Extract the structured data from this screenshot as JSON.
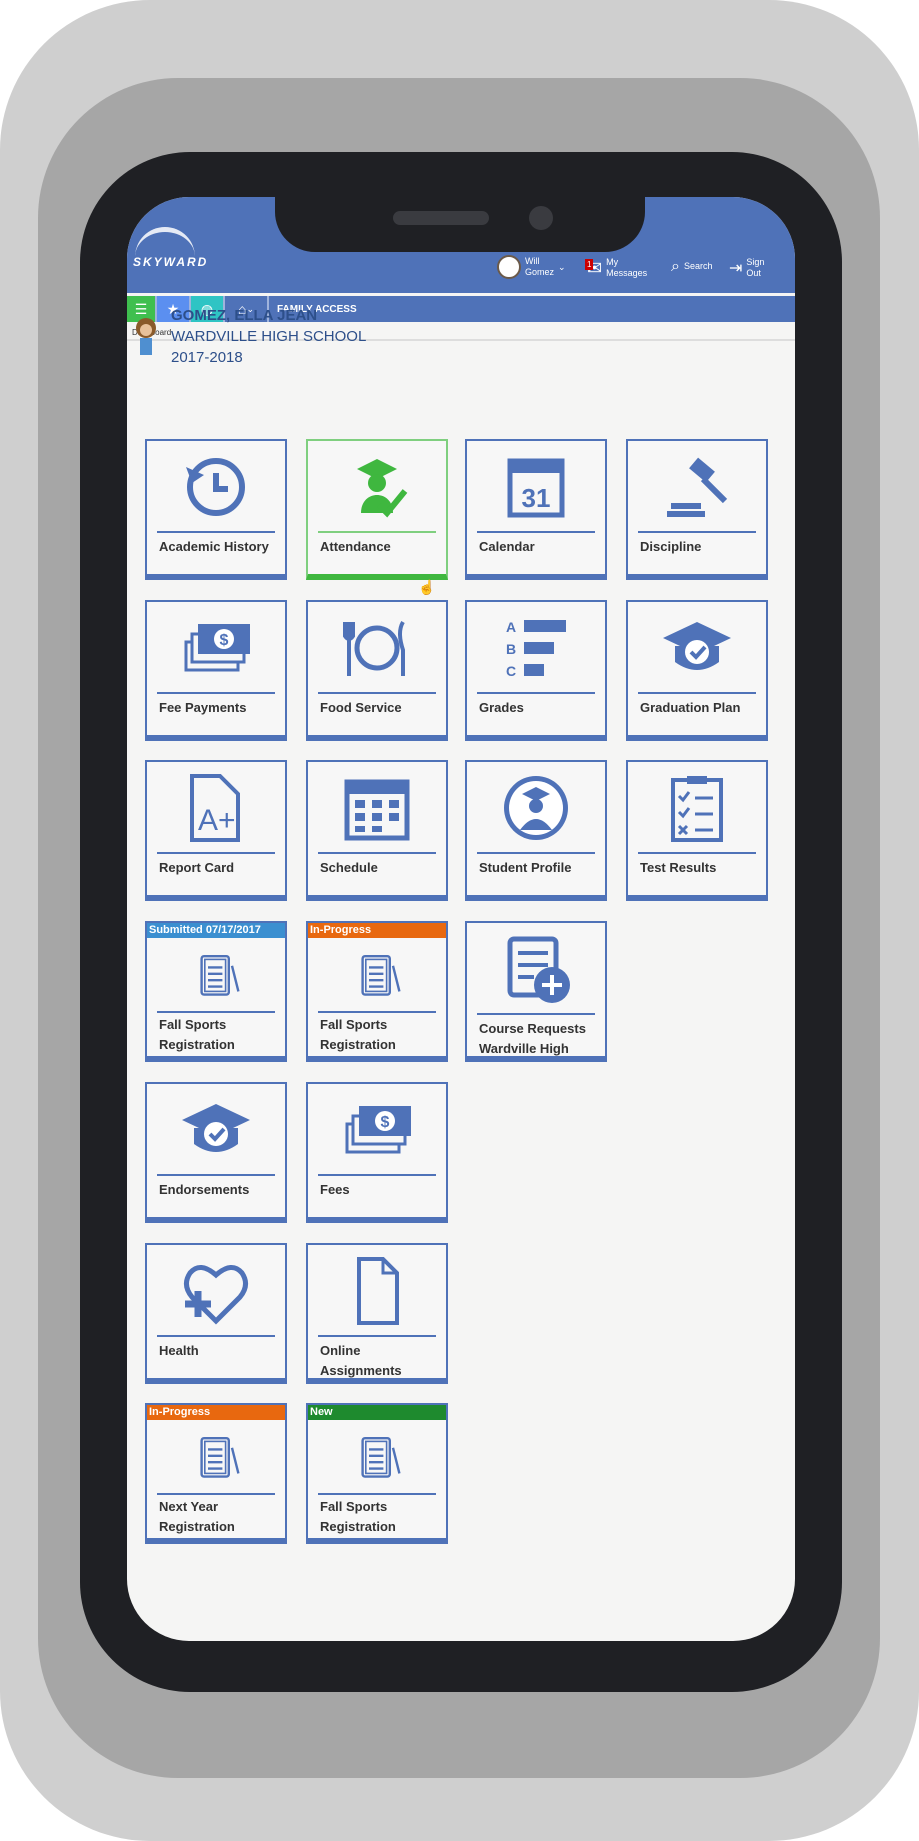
{
  "app": {
    "logo": "SKYWARD",
    "section": "FAMILY ACCESS",
    "breadcrumb": "Dashboard"
  },
  "header": {
    "user_first": "Will",
    "user_last": "Gomez",
    "messages_count": "1",
    "messages_line1": "My",
    "messages_line2": "Messages",
    "search": "Search",
    "signout_line1": "Sign",
    "signout_line2": "Out"
  },
  "student": {
    "name": "GOMEZ, ELLA JEAN",
    "school": "WARDVILLE HIGH SCHOOL",
    "year": "2017-2018"
  },
  "colors": {
    "brand": "#4f72b8",
    "green": "#3fb73f",
    "orange": "#e8680f",
    "submitted": "#3b8fd0",
    "new": "#1e8a2e"
  },
  "tiles": [
    {
      "label": "Academic History",
      "icon": "history-icon"
    },
    {
      "label": "Attendance",
      "icon": "graduate-check-icon",
      "active": true
    },
    {
      "label": "Calendar",
      "icon": "calendar-31-icon",
      "day": "31"
    },
    {
      "label": "Discipline",
      "icon": "gavel-icon"
    },
    {
      "label": "Fee Payments",
      "icon": "money-icon"
    },
    {
      "label": "Food Service",
      "icon": "plate-icon"
    },
    {
      "label": "Grades",
      "icon": "grades-bars-icon",
      "letters": [
        "A",
        "B",
        "C"
      ]
    },
    {
      "label": "Graduation Plan",
      "icon": "cap-check-icon"
    },
    {
      "label": "Report Card",
      "icon": "report-card-icon",
      "grade": "A+"
    },
    {
      "label": "Schedule",
      "icon": "schedule-icon"
    },
    {
      "label": "Student Profile",
      "icon": "student-profile-icon"
    },
    {
      "label": "Test Results",
      "icon": "checklist-icon"
    },
    {
      "label1": "Fall Sports",
      "label2": "Registration",
      "icon": "clipboard-icon",
      "badge": "Submitted 07/17/2017"
    },
    {
      "label1": "Fall Sports",
      "label2": "Registration",
      "icon": "clipboard-icon",
      "badge": "In-Progress"
    },
    {
      "label1": "Course Requests",
      "label2": "Wardville High",
      "icon": "course-add-icon"
    },
    {
      "label": "Endorsements",
      "icon": "cap-check-icon"
    },
    {
      "label": "Fees",
      "icon": "money-icon"
    },
    {
      "label": "Health",
      "icon": "heart-plus-icon"
    },
    {
      "label1": "Online",
      "label2": "Assignments",
      "icon": "document-icon"
    },
    {
      "label1": "Next Year",
      "label2": "Registration",
      "icon": "clipboard-icon",
      "badge": "In-Progress"
    },
    {
      "label1": "Fall Sports",
      "label2": "Registration",
      "icon": "clipboard-icon",
      "badge": "New"
    }
  ]
}
